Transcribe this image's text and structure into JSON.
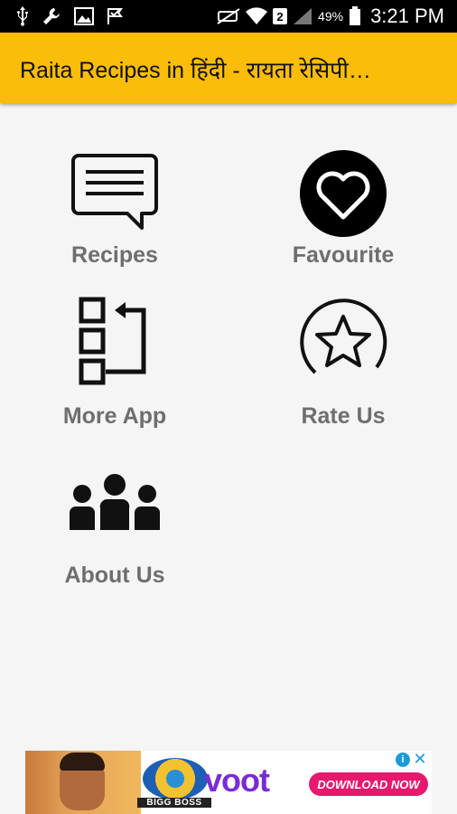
{
  "status_bar": {
    "battery_percent": "49%",
    "time": "3:21 PM",
    "sim_slot": "2",
    "icons": [
      "usb-icon",
      "wrench-icon",
      "image-icon",
      "flag-icon",
      "mute-icon",
      "wifi-icon",
      "signal-icon",
      "battery-icon"
    ]
  },
  "app_bar": {
    "title": "Raita Recipes in हिंदी - रायता रेसिपी…"
  },
  "menu": {
    "recipes": "Recipes",
    "favourite": "Favourite",
    "more_app": "More App",
    "rate_us": "Rate Us",
    "about_us": "About Us"
  },
  "ad": {
    "brand": "voot",
    "show_name": "BIGG BOSS",
    "cta": "DOWNLOAD NOW",
    "info_glyph": "i",
    "close_glyph": "✕"
  },
  "colors": {
    "app_bar": "#fbbd08",
    "label": "#6e6e6e",
    "background": "#f5f5f5"
  }
}
